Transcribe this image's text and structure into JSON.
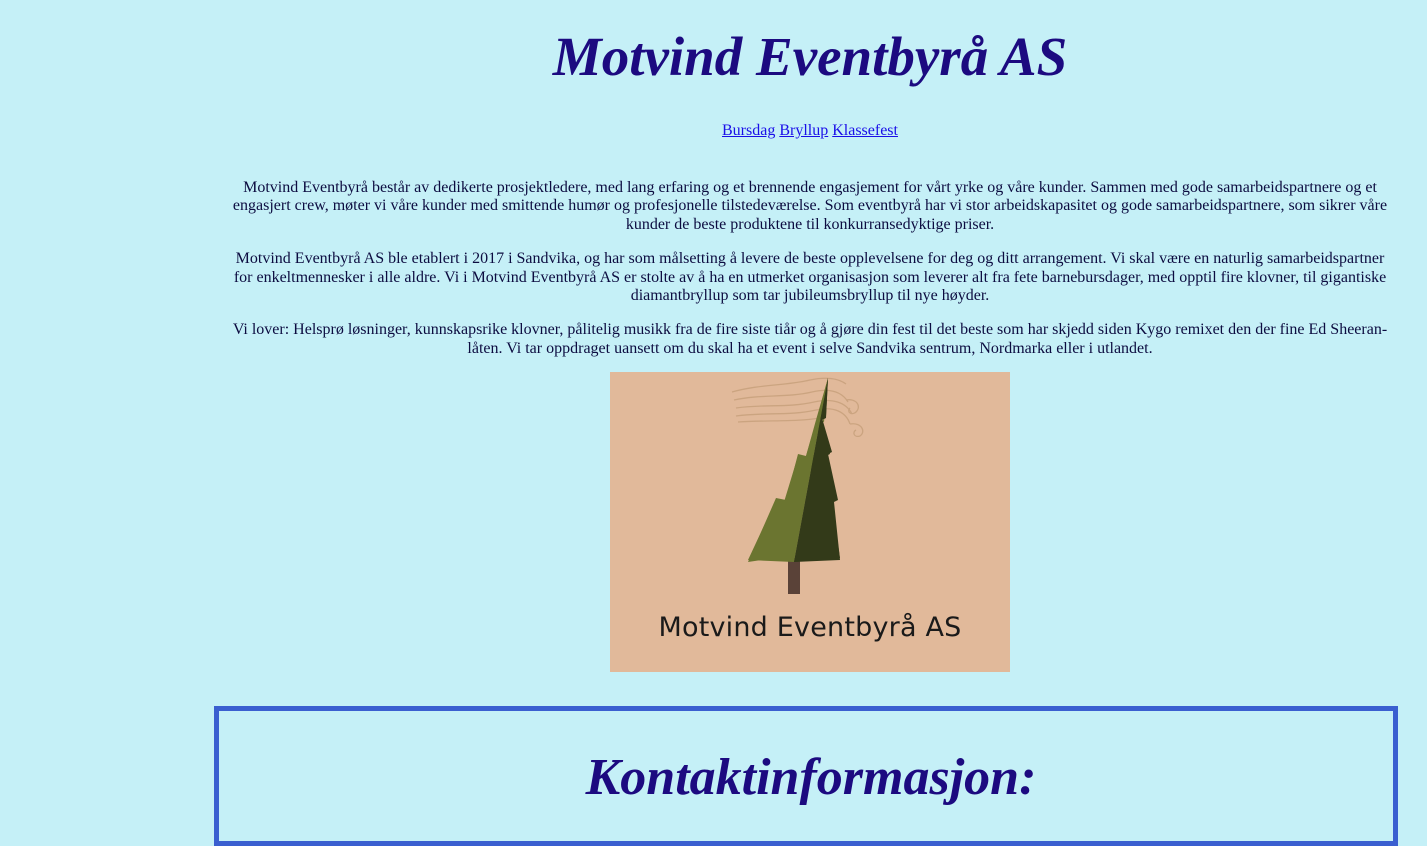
{
  "header": {
    "title": "Motvind Eventbyrå AS"
  },
  "nav": {
    "links": [
      "Bursdag",
      "Bryllup",
      "Klassefest"
    ]
  },
  "content": {
    "paragraphs": [
      "Motvind Eventbyrå består av dedikerte prosjektledere, med lang erfaring og et brennende engasjement for vårt yrke og våre kunder. Sammen med gode samarbeidspartnere og et engasjert crew, møter vi våre kunder med smittende humør og profesjonelle tilstedeværelse. Som eventbyrå har vi stor arbeidskapasitet og gode samarbeidspartnere, som sikrer våre kunder de beste produktene til konkurransedyktige priser.",
      "Motvind Eventbyrå AS ble etablert i 2017 i Sandvika, og har som målsetting å levere de beste opplevelsene for deg og ditt arrangement. Vi skal være en naturlig samarbeidspartner for enkeltmennesker i alle aldre. Vi i Motvind Eventbyrå AS er stolte av å ha en utmerket organisasjon som leverer alt fra fete barnebursdager, med opptil fire klovner, til gigantiske diamantbryllup som tar jubileumsbryllup til nye høyder.",
      "Vi lover: Helsprø løsninger, kunnskapsrike klovner, pålitelig musikk fra de fire siste tiår og å gjøre din fest til det beste som har skjedd siden Kygo remixet den der fine Ed Sheeran-låten. Vi tar oppdraget uansett om du skal ha et event i selve Sandvika sentrum, Nordmarka eller i utlandet."
    ]
  },
  "logo": {
    "text": "Motvind Eventbyrå AS",
    "icon": "pine-tree-wind-icon",
    "colors": {
      "background": "#e1b99a",
      "tree_light": "#6b7530",
      "tree_dark": "#333a19",
      "trunk": "#5a4238"
    }
  },
  "contact": {
    "heading": "Kontaktinformasjon:"
  },
  "colors": {
    "page_background": "#c5f0f7",
    "heading": "#1c0a80",
    "link": "#1a0ee8",
    "contact_border": "#3a5fd0"
  }
}
